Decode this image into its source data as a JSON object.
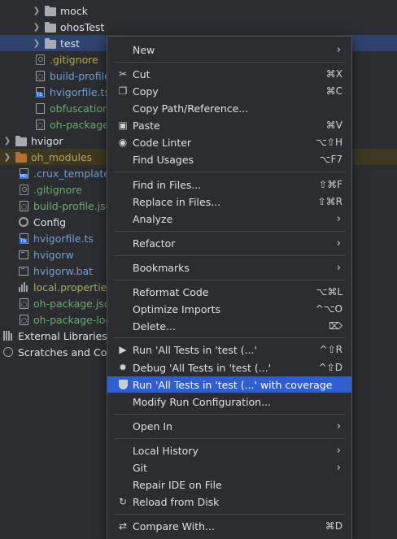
{
  "tree": {
    "rows": [
      {
        "label": "mock"
      },
      {
        "label": "ohosTest"
      },
      {
        "label": "test"
      },
      {
        "label": ".gitignore"
      },
      {
        "label": "build-profile."
      },
      {
        "label": "hvigorfile.ts"
      },
      {
        "label": "obfuscation-"
      },
      {
        "label": "oh-package."
      },
      {
        "label": "hvigor"
      },
      {
        "label": "oh_modules"
      },
      {
        "label": ".crux_template."
      },
      {
        "label": ".gitignore"
      },
      {
        "label": "build-profile.jso"
      },
      {
        "label": "Config"
      },
      {
        "label": "hvigorfile.ts"
      },
      {
        "label": "hvigorw"
      },
      {
        "label": "hvigorw.bat"
      },
      {
        "label": "local.properties"
      },
      {
        "label": "oh-package.jso"
      },
      {
        "label": "oh-package-loc"
      },
      {
        "label": "External Libraries"
      },
      {
        "label": "Scratches and Cor"
      }
    ]
  },
  "menu": {
    "new": {
      "label": "New"
    },
    "cut": {
      "label": "Cut",
      "shortcut": "⌘X"
    },
    "copy": {
      "label": "Copy",
      "shortcut": "⌘C"
    },
    "copy_path": {
      "label": "Copy Path/Reference..."
    },
    "paste": {
      "label": "Paste",
      "shortcut": "⌘V"
    },
    "code_linter": {
      "label": "Code Linter",
      "shortcut": "⌥⇧H"
    },
    "find_usages": {
      "label": "Find Usages",
      "shortcut": "⌥F7"
    },
    "find_in_files": {
      "label": "Find in Files...",
      "shortcut": "⇧⌘F"
    },
    "replace_in_files": {
      "label": "Replace in Files...",
      "shortcut": "⇧⌘R"
    },
    "analyze": {
      "label": "Analyze"
    },
    "refactor": {
      "label": "Refactor"
    },
    "bookmarks": {
      "label": "Bookmarks"
    },
    "reformat_code": {
      "label": "Reformat Code",
      "shortcut": "⌥⌘L"
    },
    "optimize_imports": {
      "label": "Optimize Imports",
      "shortcut": "^⌥O"
    },
    "delete": {
      "label": "Delete...",
      "shortcut": "⌦"
    },
    "run_tests": {
      "label": "Run 'All Tests in 'test (...'",
      "shortcut": "^⇧R"
    },
    "debug_tests": {
      "label": "Debug 'All Tests in 'test (...'",
      "shortcut": "^⇧D"
    },
    "run_coverage": {
      "label": "Run 'All Tests in 'test (...' with coverage"
    },
    "modify_run_config": {
      "label": "Modify Run Configuration..."
    },
    "open_in": {
      "label": "Open In"
    },
    "local_history": {
      "label": "Local History"
    },
    "git": {
      "label": "Git"
    },
    "repair_ide": {
      "label": "Repair IDE on File"
    },
    "reload_disk": {
      "label": "Reload from Disk"
    },
    "compare_with": {
      "label": "Compare With...",
      "shortcut": "⌘D"
    }
  },
  "colors": {
    "background": "#2b2d30",
    "selection": "#2e5ecf",
    "tree_selection": "#2e436e"
  }
}
